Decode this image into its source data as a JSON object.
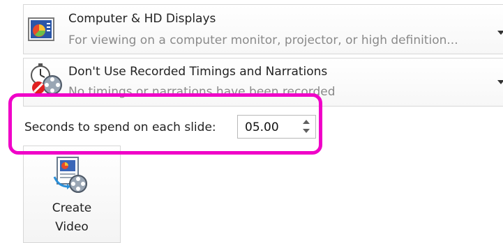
{
  "quality_dropdown": {
    "title": "Computer & HD Displays",
    "subtitle": "For viewing on a computer monitor, projector, or high definition...",
    "icon": "display-icon"
  },
  "timings_dropdown": {
    "title": "Don't Use Recorded Timings and Narrations",
    "subtitle": "No timings or narrations have been recorded",
    "icon": "stopwatch-film-icon"
  },
  "seconds": {
    "label": "Seconds to spend on each slide:",
    "value": "05.00"
  },
  "create_video": {
    "line1": "Create",
    "line2": "Video",
    "icon": "create-video-icon"
  },
  "colors": {
    "highlight": "#f000c8"
  }
}
